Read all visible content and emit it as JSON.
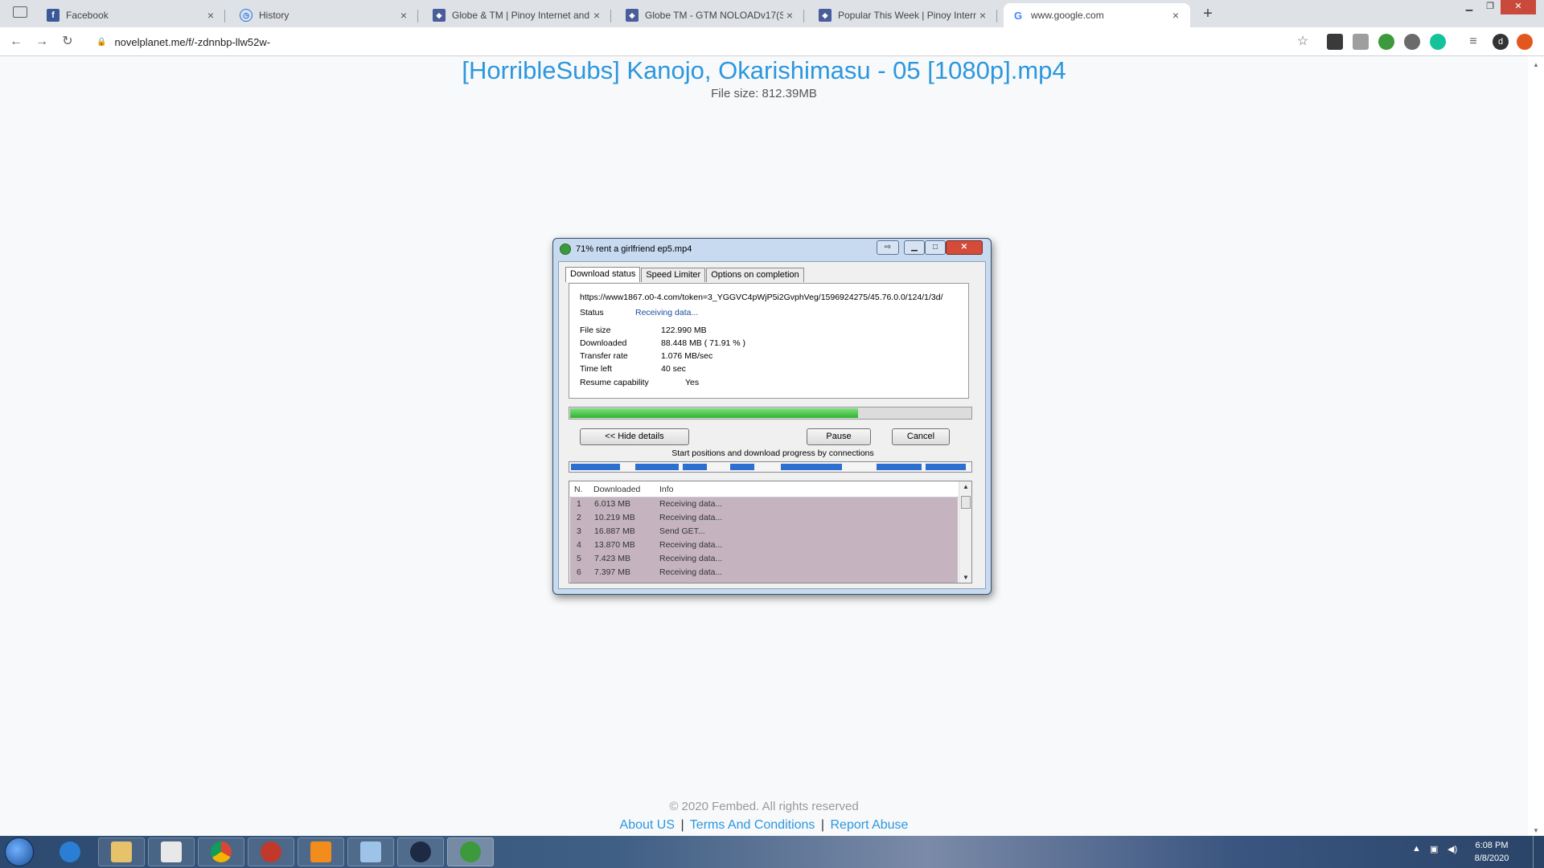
{
  "browser": {
    "tabs": [
      {
        "title": "Facebook",
        "icon": "facebook-icon"
      },
      {
        "title": "History",
        "icon": "history-icon"
      },
      {
        "title": "Globe & TM | Pinoy Internet and",
        "icon": "shield-icon"
      },
      {
        "title": "Globe TM - GTM NOLOADv17(S",
        "icon": "shield-icon"
      },
      {
        "title": "Popular This Week | Pinoy Interne",
        "icon": "shield-icon"
      },
      {
        "title": "www.google.com",
        "icon": "google-icon"
      }
    ],
    "new_tab": "+",
    "url": "novelplanet.me/f/-zdnnbp-llw52w-",
    "profile_initial": "d"
  },
  "page": {
    "title": "[HorribleSubs] Kanojo, Okarishimasu - 05 [1080p].mp4",
    "file_size": "File size: 812.39MB",
    "copyright": "© 2020 Fembed. All rights reserved",
    "links": [
      "About US",
      "Terms And Conditions",
      "Report Abuse"
    ],
    "link_separator": "|"
  },
  "dialog": {
    "title": "71% rent a girlfriend ep5.mp4",
    "tabs": [
      "Download status",
      "Speed Limiter",
      "Options on completion"
    ],
    "url": "https://www1867.o0-4.com/token=3_YGGVC4pWjP5i2GvphVeg/1596924275/45.76.0.0/124/1/3d/",
    "status_label": "Status",
    "status_value": "Receiving data...",
    "details": [
      {
        "label": "File size",
        "value": "122.990  MB"
      },
      {
        "label": "Downloaded",
        "value": "88.448  MB  ( 71.91 % )"
      },
      {
        "label": "Transfer rate",
        "value": "1.076  MB/sec"
      },
      {
        "label": "Time left",
        "value": "40 sec"
      },
      {
        "label": "Resume capability",
        "value": "Yes"
      }
    ],
    "progress_percent": 71.91,
    "buttons": {
      "hide_details": "<< Hide details",
      "pause": "Pause",
      "cancel": "Cancel"
    },
    "connections_caption": "Start positions and download progress by connections",
    "table": {
      "headers": [
        "N.",
        "Downloaded",
        "Info"
      ],
      "rows": [
        [
          "1",
          "6.013  MB",
          "Receiving data..."
        ],
        [
          "2",
          "10.219  MB",
          "Receiving data..."
        ],
        [
          "3",
          "16.887  MB",
          "Send GET..."
        ],
        [
          "4",
          "13.870  MB",
          "Receiving data..."
        ],
        [
          "5",
          "7.423  MB",
          "Receiving data..."
        ],
        [
          "6",
          "7.397  MB",
          "Receiving data..."
        ]
      ]
    }
  },
  "taskbar": {
    "apps": [
      "internet-explorer-icon",
      "file-explorer-icon",
      "media-player-icon",
      "chrome-icon",
      "garena-icon",
      "vlc-icon",
      "notepad-icon",
      "app-icon",
      "idm-icon"
    ],
    "time": "6:08 PM",
    "date": "8/8/2020"
  },
  "colors": {
    "link": "#2c97de",
    "progress": "#2fb32f",
    "connection_segment": "#2d6fd1"
  }
}
